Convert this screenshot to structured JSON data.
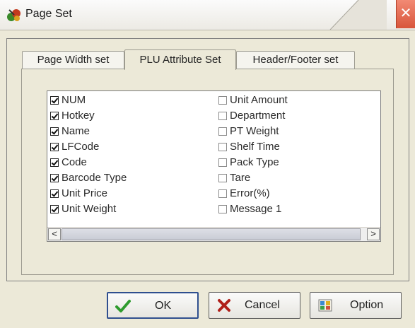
{
  "window": {
    "title": "Page Set",
    "icon": "scale-app-icon",
    "close_glyph": "✕"
  },
  "tabs": [
    {
      "label": "Page Width set",
      "active": false
    },
    {
      "label": "PLU Attribute Set",
      "active": true
    },
    {
      "label": "Header/Footer set",
      "active": false
    }
  ],
  "attributes_left": [
    {
      "label": "NUM",
      "checked": true
    },
    {
      "label": "Hotkey",
      "checked": true
    },
    {
      "label": "Name",
      "checked": true
    },
    {
      "label": "LFCode",
      "checked": true
    },
    {
      "label": "Code",
      "checked": true
    },
    {
      "label": "Barcode Type",
      "checked": true
    },
    {
      "label": "Unit Price",
      "checked": true
    },
    {
      "label": "Unit Weight",
      "checked": true
    }
  ],
  "attributes_right": [
    {
      "label": "Unit Amount",
      "checked": false
    },
    {
      "label": "Department",
      "checked": false
    },
    {
      "label": "PT Weight",
      "checked": false
    },
    {
      "label": "Shelf Time",
      "checked": false
    },
    {
      "label": "Pack Type",
      "checked": false
    },
    {
      "label": "Tare",
      "checked": false
    },
    {
      "label": "Error(%)",
      "checked": false
    },
    {
      "label": "Message 1",
      "checked": false
    }
  ],
  "scrollbar": {
    "left_arrow": "<",
    "right_arrow": ">"
  },
  "buttons": {
    "ok": "OK",
    "cancel": "Cancel",
    "option": "Option"
  },
  "colors": {
    "close_button": "#d8553b",
    "ok_check": "#2e9b2e",
    "cancel_x": "#b0201a",
    "default_border": "#2f4f8f"
  }
}
